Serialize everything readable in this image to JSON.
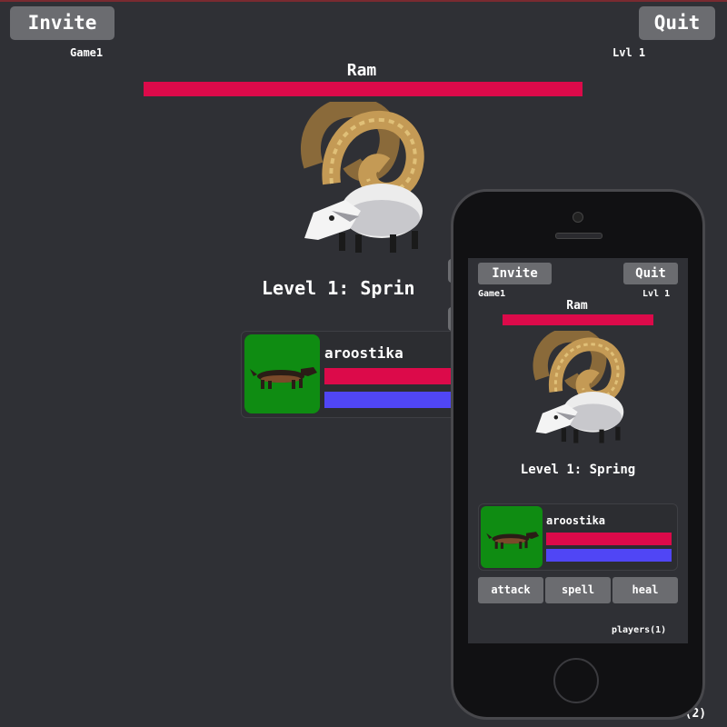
{
  "desktop": {
    "invite_label": "Invite",
    "quit_label": "Quit",
    "game_name": "Game1",
    "level_short": "Lvl 1",
    "boss_name": "Ram",
    "level_title": "Level 1: Sprin",
    "player_name": "aroostika",
    "players_partial": "rs(2)"
  },
  "phone": {
    "invite_label": "Invite",
    "quit_label": "Quit",
    "game_name": "Game1",
    "level_short": "Lvl 1",
    "boss_name": "Ram",
    "level_title": "Level 1: Spring",
    "player_name": "aroostika",
    "actions": [
      "attack",
      "spell",
      "heal"
    ],
    "players_count": "players(1)"
  },
  "colors": {
    "background": "#2f3035",
    "button": "#6b6c70",
    "health_bar": "#dc0a4a",
    "mana_bar": "#5046f5",
    "portrait": "#0f8c12"
  },
  "icons": {
    "boss": "ram-sprite",
    "player": "dachshund-sprite",
    "phone_frame": "smartphone-mockup"
  },
  "stats": {
    "boss_health_fraction": 1.0,
    "player_health_fraction": 1.0,
    "player_mana_fraction": 1.0
  }
}
